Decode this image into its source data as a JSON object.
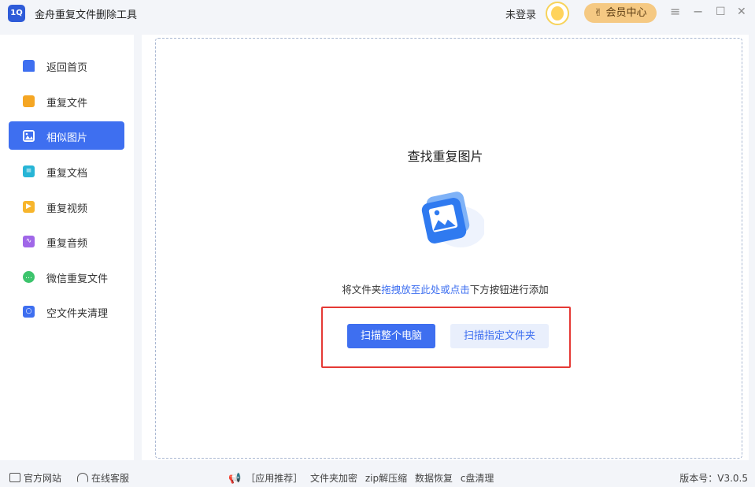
{
  "app": {
    "title": "金舟重复文件删除工具",
    "logo_text": "1Q"
  },
  "header": {
    "login_text": "未登录",
    "vip_label": "会员中心",
    "menu_glyph": "≡",
    "minimize_glyph": "−",
    "maximize_glyph": "☐",
    "close_glyph": "✕"
  },
  "sidebar": {
    "items": [
      {
        "label": "返回首页",
        "icon": "home-icon",
        "color": "#3e6ff0",
        "active": false
      },
      {
        "label": "重复文件",
        "icon": "folder-icon",
        "color": "#f5a623",
        "active": false
      },
      {
        "label": "相似图片",
        "icon": "image-icon",
        "color": "#ffffff",
        "active": true
      },
      {
        "label": "重复文档",
        "icon": "document-icon",
        "color": "#27b5d6",
        "active": false
      },
      {
        "label": "重复视频",
        "icon": "video-icon",
        "color": "#f7b52c",
        "active": false
      },
      {
        "label": "重复音频",
        "icon": "audio-icon",
        "color": "#a067e8",
        "active": false
      },
      {
        "label": "微信重复文件",
        "icon": "wechat-icon",
        "color": "#3cc46c",
        "active": false
      },
      {
        "label": "空文件夹清理",
        "icon": "empty-folder-icon",
        "color": "#3e6ff0",
        "active": false
      }
    ]
  },
  "main": {
    "title": "查找重复图片",
    "hint_prefix": "将文件夹",
    "hint_link": "拖拽放至此处或点击",
    "hint_suffix": "下方按钮进行添加",
    "scan_all_label": "扫描整个电脑",
    "scan_folder_label": "扫描指定文件夹"
  },
  "footer": {
    "website": "官方网站",
    "support": "在线客服",
    "promo_prefix": "［应用推荐］",
    "promo_links": [
      "文件夹加密",
      "zip解压缩",
      "数据恢复",
      "c盘清理"
    ],
    "version": "版本号：V3.0.5"
  },
  "colors": {
    "accent": "#3e6ff0",
    "highlight": "#e53935",
    "vip": "#f5c983"
  }
}
